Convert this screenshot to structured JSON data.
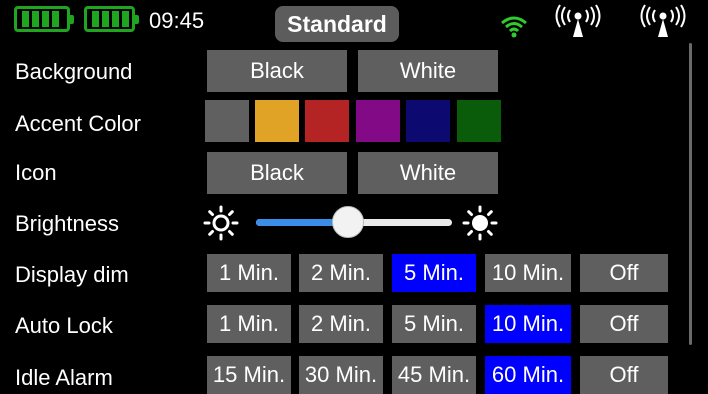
{
  "status": {
    "time": "09:45",
    "profile": "Standard",
    "battery_color": "#1fa51f",
    "wifi_color": "#2ecc2e",
    "icons": [
      "battery-icon",
      "battery-icon",
      "wifi-icon",
      "antenna-icon",
      "antenna-icon"
    ]
  },
  "rows": {
    "background": {
      "label": "Background",
      "options": [
        "Black",
        "White"
      ]
    },
    "accent": {
      "label": "Accent Color",
      "colors": [
        "#606060",
        "#e0a326",
        "#b52424",
        "#820a86",
        "#0c0a70",
        "#0a5c0a"
      ]
    },
    "icon": {
      "label": "Icon",
      "options": [
        "Black",
        "White"
      ]
    },
    "brightness": {
      "label": "Brightness",
      "value_fraction": 0.47,
      "track_color": "#3a8ee8"
    },
    "display_dim": {
      "label": "Display dim",
      "options": [
        "1 Min.",
        "2 Min.",
        "5 Min.",
        "10 Min.",
        "Off"
      ],
      "selected": "5 Min."
    },
    "auto_lock": {
      "label": "Auto Lock",
      "options": [
        "1 Min.",
        "2 Min.",
        "5 Min.",
        "10 Min.",
        "Off"
      ],
      "selected": "10 Min."
    },
    "idle_alarm": {
      "label": "Idle Alarm",
      "options": [
        "15 Min.",
        "30 Min.",
        "45 Min.",
        "60 Min.",
        "Off"
      ],
      "selected": "60 Min."
    }
  },
  "selected_color": "#0000ff"
}
